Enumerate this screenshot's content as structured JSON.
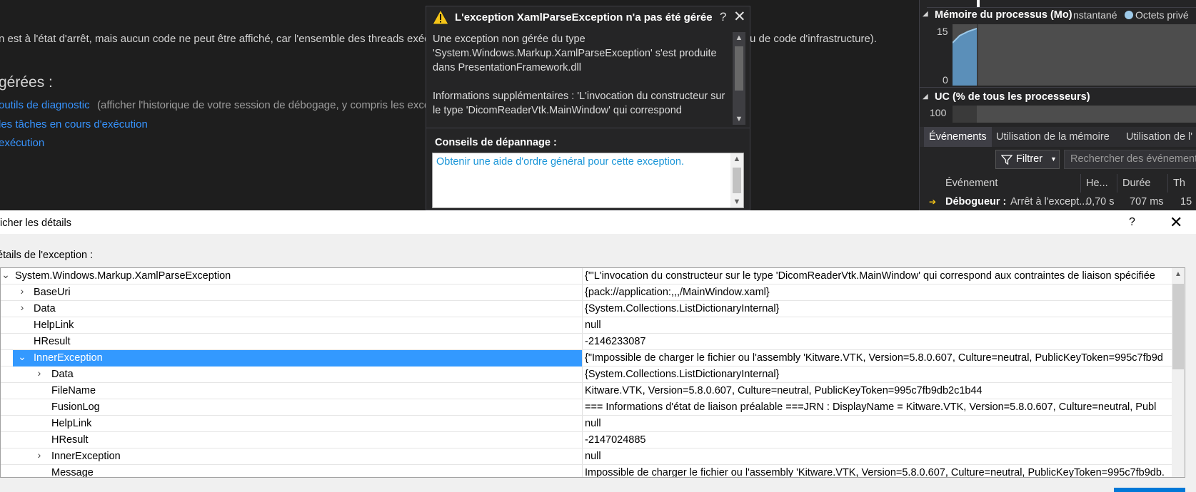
{
  "background_editor": {
    "line1": "n est à l'état d'arrêt, mais aucun code ne peut être affiché, car l'ensemble des threads exécu",
    "line1_tail": "u de code d'infrastructure).",
    "heading": "gérées :",
    "link1": "outils de diagnostic",
    "link1_desc": "(afficher l'historique de votre session de débogage, y compris les exce",
    "link2": "les tâches en cours d'exécution",
    "link3": "exécution"
  },
  "exception_popup": {
    "title": "L'exception XamlParseException n'a pas été gérée",
    "help_label": "?",
    "close_label": "✕",
    "message_p1": "Une exception non gérée du type 'System.Windows.Markup.XamlParseException' s'est produite dans PresentationFramework.dll",
    "message_p2": "Informations supplémentaires : 'L'invocation du constructeur sur le type 'DicomReaderVtk.MainWindow' qui correspond",
    "tips_title": "Conseils de dépannage :",
    "tips_link": "Obtenir une aide d'ordre général pour cette exception."
  },
  "diagnostics": {
    "memory_header": "Mémoire du processus (Mo)",
    "memory_legend_1": "nstantané",
    "memory_legend_2": "Octets privé",
    "memory_max": "15",
    "memory_min": "0",
    "cpu_header": "UC (% de tous les processeurs)",
    "cpu_max": "100",
    "tabs": [
      {
        "label": "Événements",
        "active": true
      },
      {
        "label": "Utilisation de la mémoire",
        "active": false
      },
      {
        "label": "Utilisation de l'",
        "active": false
      }
    ],
    "filter_label": "Filtrer",
    "search_placeholder": "Rechercher des événements",
    "columns": [
      "Événement",
      "He...",
      "Durée",
      "Th"
    ],
    "event_row": {
      "bold": "Débogueur :",
      "text": "Arrêt à l'except...",
      "time": "0,70 s",
      "duration": "707 ms",
      "thread": "15"
    }
  },
  "details_dialog": {
    "title": "ficher les détails",
    "help_label": "?",
    "close_label": "✕",
    "section_label": "étails de l'exception :",
    "rows": [
      {
        "name": "System.Windows.Markup.XamlParseException",
        "value": "{\"'L'invocation du constructeur sur le type 'DicomReaderVtk.MainWindow' qui correspond aux contraintes de liaison spécifiée",
        "expander": "⌄",
        "level": 0,
        "selected": false
      },
      {
        "name": "BaseUri",
        "value": "{pack://application:,,,/MainWindow.xaml}",
        "expander": "›",
        "level": 1,
        "selected": false
      },
      {
        "name": "Data",
        "value": "{System.Collections.ListDictionaryInternal}",
        "expander": "›",
        "level": 1,
        "selected": false
      },
      {
        "name": "HelpLink",
        "value": "null",
        "expander": "",
        "level": 1,
        "selected": false
      },
      {
        "name": "HResult",
        "value": "-2146233087",
        "expander": "",
        "level": 1,
        "selected": false
      },
      {
        "name": "InnerException",
        "value": "{\"Impossible de charger le fichier ou l'assembly 'Kitware.VTK, Version=5.8.0.607, Culture=neutral, PublicKeyToken=995c7fb9d",
        "expander": "⌄",
        "level": 1,
        "selected": true
      },
      {
        "name": "Data",
        "value": "{System.Collections.ListDictionaryInternal}",
        "expander": "›",
        "level": 2,
        "selected": false
      },
      {
        "name": "FileName",
        "value": "Kitware.VTK, Version=5.8.0.607, Culture=neutral, PublicKeyToken=995c7fb9db2c1b44",
        "expander": "",
        "level": 2,
        "selected": false
      },
      {
        "name": "FusionLog",
        "value": "=== Informations d'état de liaison préalable ===JRN : DisplayName = Kitware.VTK, Version=5.8.0.607, Culture=neutral, Publ",
        "expander": "",
        "level": 2,
        "selected": false
      },
      {
        "name": "HelpLink",
        "value": "null",
        "expander": "",
        "level": 2,
        "selected": false
      },
      {
        "name": "HResult",
        "value": "-2147024885",
        "expander": "",
        "level": 2,
        "selected": false
      },
      {
        "name": "InnerException",
        "value": "null",
        "expander": "›",
        "level": 2,
        "selected": false
      },
      {
        "name": "Message",
        "value": "Impossible de charger le fichier ou l'assembly 'Kitware.VTK, Version=5.8.0.607, Culture=neutral, PublicKeyToken=995c7fb9db.",
        "expander": "",
        "level": 2,
        "selected": false
      }
    ]
  }
}
